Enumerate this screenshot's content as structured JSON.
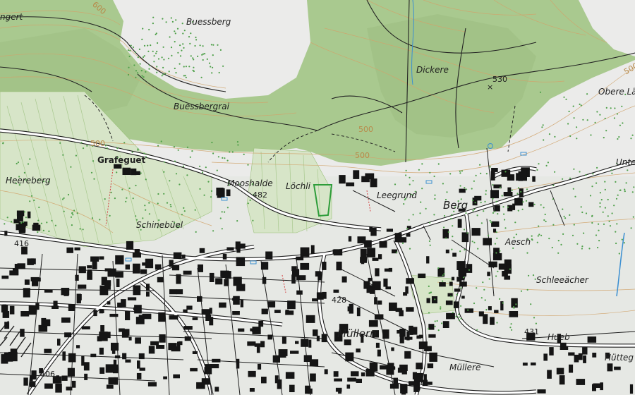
{
  "colors": {
    "background": "#ebebea",
    "forest": "#a9c98f",
    "forest_dark": "#9fc083",
    "building": "#151515",
    "road": "#1e1e1e",
    "contour": "#d1a46c",
    "water": "#3b8fd1",
    "vineyard": "#9bc07b"
  },
  "labels": {
    "angert": "ngert",
    "buessberg": "Buessberg",
    "buessbergrai": "Buessbergrai",
    "dickere": "Dickere",
    "obere_la": "Obere Lä",
    "unte": "Unte",
    "grafeguet": "Grafeguet",
    "heereberg": "Heereberg",
    "mooshalde": "Mooshalde",
    "lochli": "Löchli",
    "leegrund": "Leegrund",
    "berg": "Berg",
    "schinebuel": "Schinebüel",
    "aesch": "Aesch",
    "schleeacher": "Schleeächer",
    "mullern": "Müllern",
    "hueb": "Hueb",
    "huttege": "Hütteg",
    "mullere": "Müllere"
  },
  "spot_heights": {
    "h530": "530",
    "h482": "482",
    "h416": "416",
    "h428": "428",
    "h431": "431",
    "h406": "406"
  },
  "contour_labels": {
    "c600": "600",
    "c500a": "500",
    "c500b": "500",
    "c500c": "500",
    "c500d": "500"
  }
}
